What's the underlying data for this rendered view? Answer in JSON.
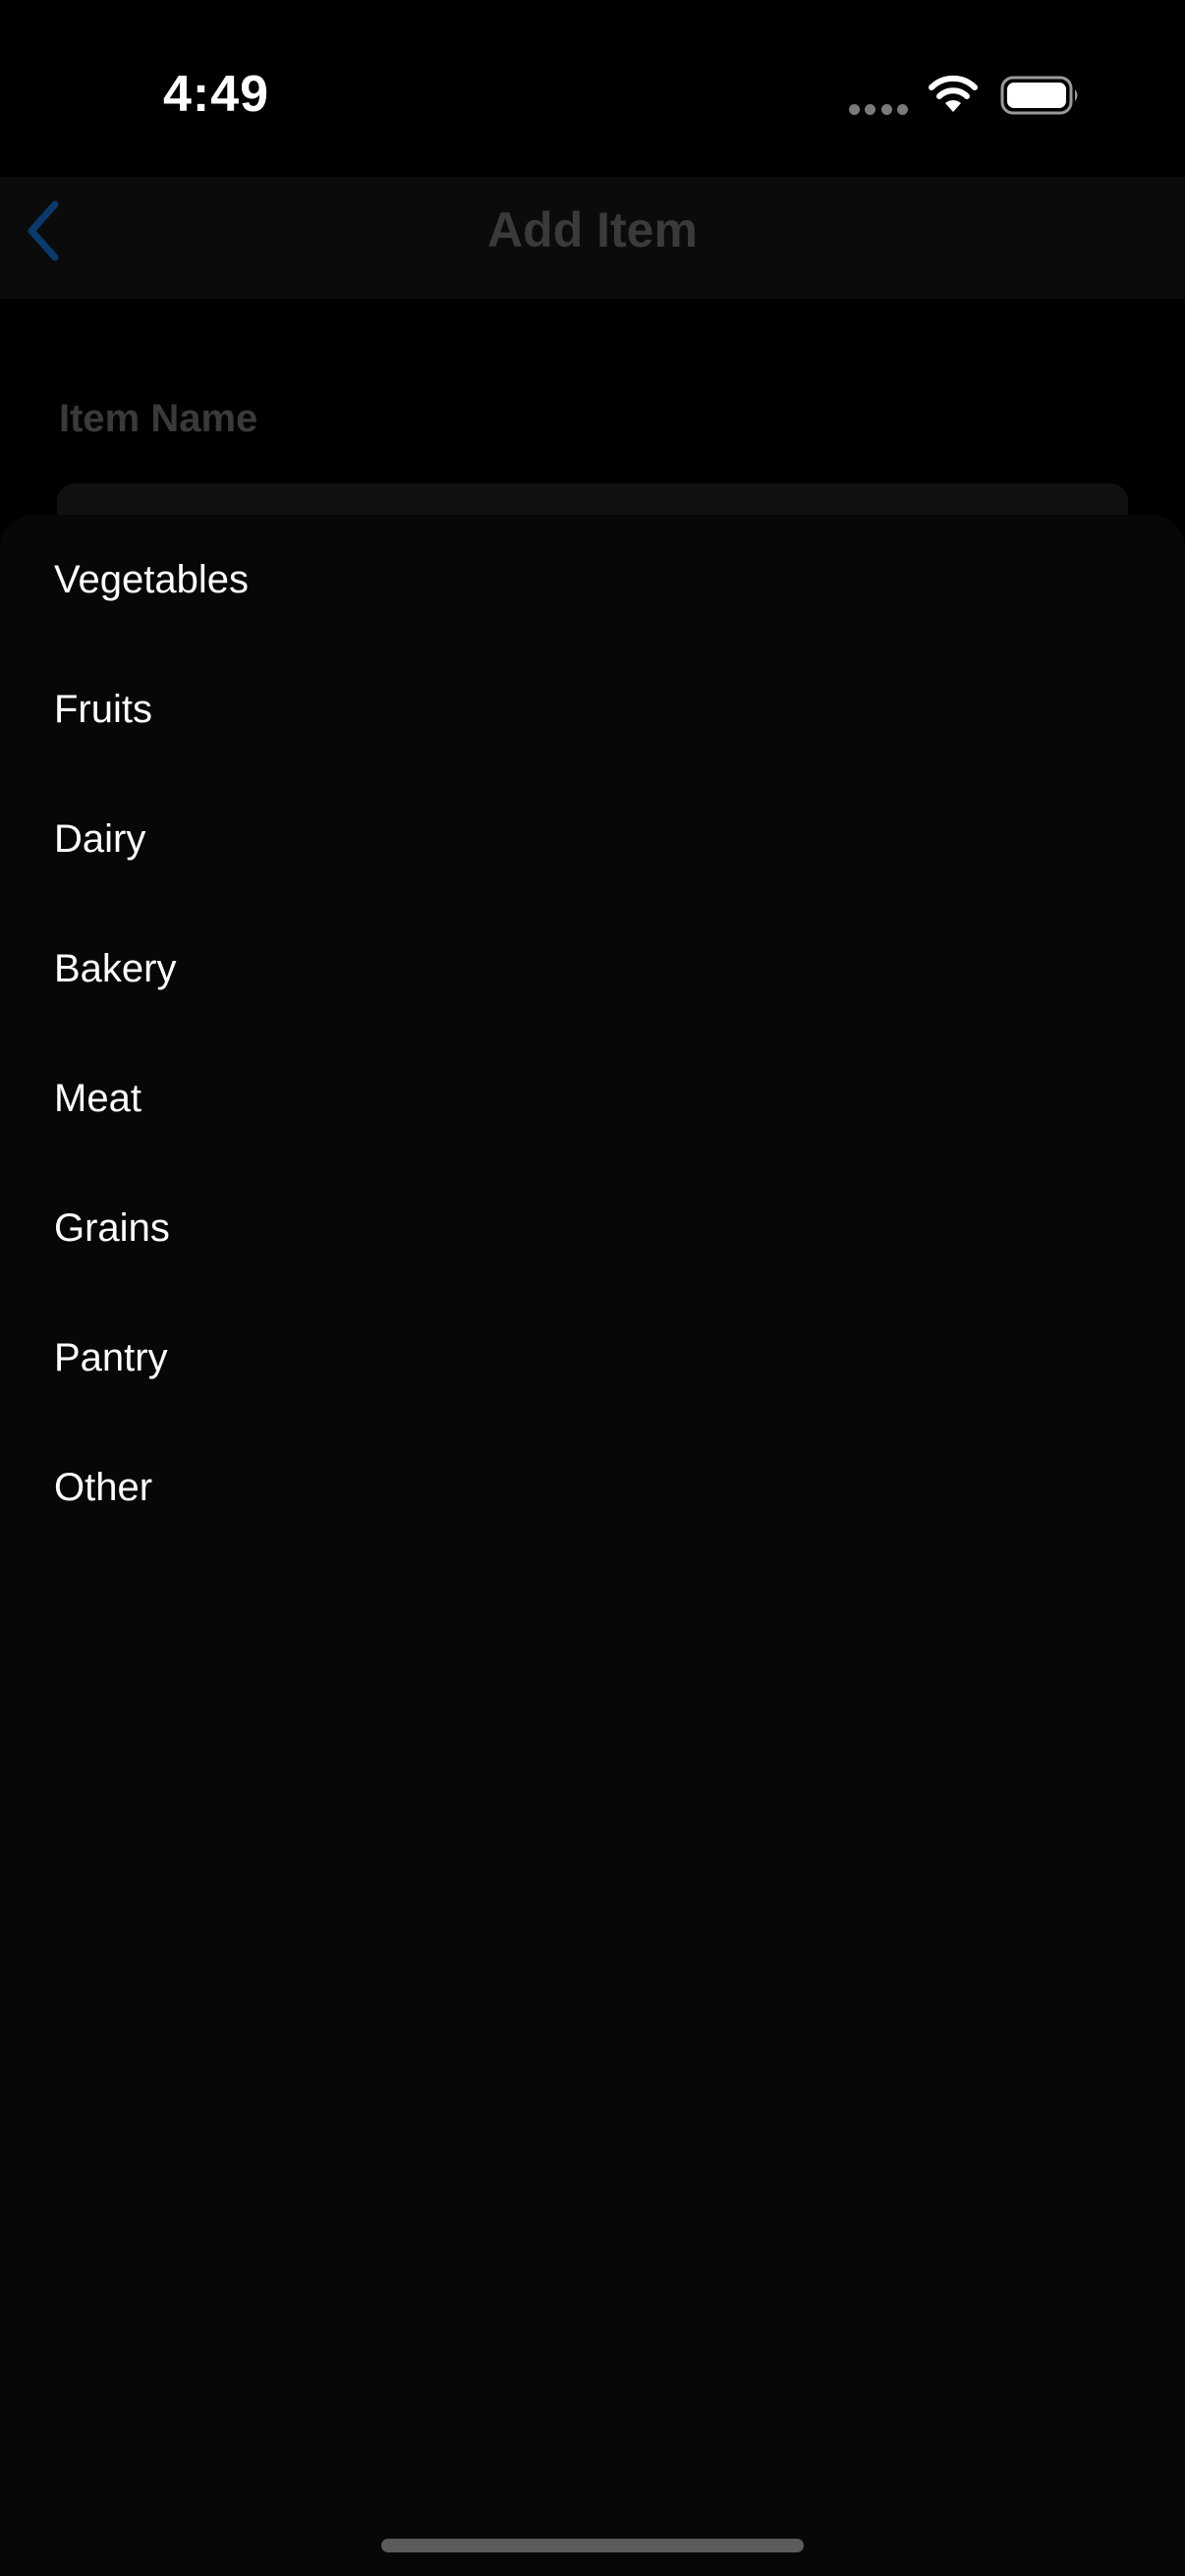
{
  "status_bar": {
    "time": "4:49",
    "icons": [
      "signal-dots-icon",
      "wifi-icon",
      "battery-icon"
    ]
  },
  "nav": {
    "title": "Add Item",
    "back_icon": "chevron-left-icon"
  },
  "form": {
    "item_name_label": "Item Name",
    "item_name_value": ""
  },
  "category_sheet": {
    "options": [
      {
        "label": "Vegetables"
      },
      {
        "label": "Fruits"
      },
      {
        "label": "Dairy"
      },
      {
        "label": "Bakery"
      },
      {
        "label": "Meat"
      },
      {
        "label": "Grains"
      },
      {
        "label": "Pantry"
      },
      {
        "label": "Other"
      }
    ]
  },
  "colors": {
    "background": "#000000",
    "sheet_background": "#070707",
    "accent_dimmed": "#0a3a6b",
    "option_text": "#ffffff",
    "dimmed_text": "#3a3a3c"
  }
}
